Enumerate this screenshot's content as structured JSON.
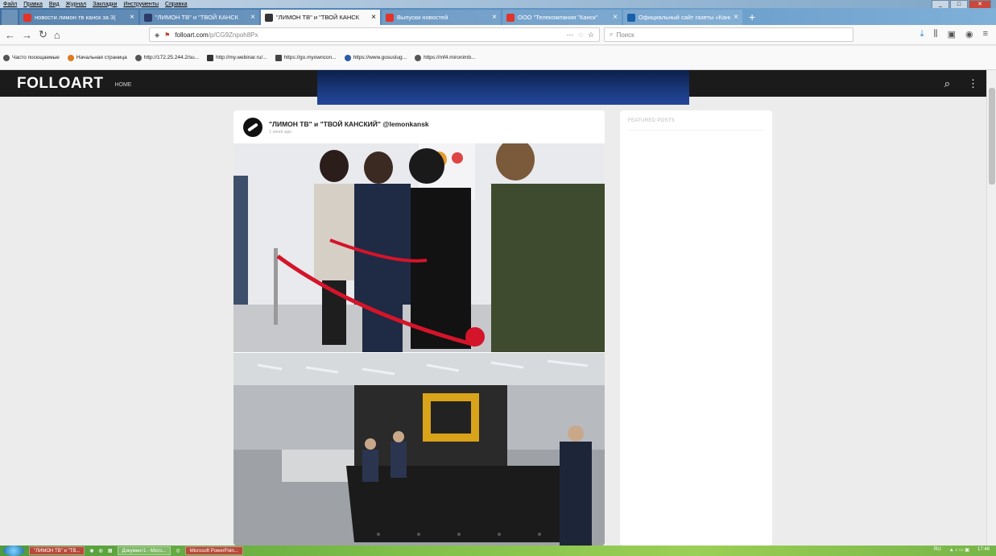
{
  "menu": [
    "Файл",
    "Правка",
    "Вид",
    "Журнал",
    "Закладки",
    "Инструменты",
    "Справка"
  ],
  "window_controls": [
    "_",
    "□",
    "✕"
  ],
  "tabs": [
    {
      "title": "новости лимон тв канск за 3(",
      "icon_color": "#e0342a"
    },
    {
      "title": "\"ЛИМОН ТВ\" и \"ТВОЙ КАНСК",
      "icon_color": "#2b3a67"
    },
    {
      "title": "\"ЛИМОН ТВ\" и \"ТВОЙ КАНСК",
      "icon_color": "#333333",
      "active": true
    },
    {
      "title": "Выпуски новостей",
      "icon_color": "#e0342a"
    },
    {
      "title": "ООО \"Телекомпания \"Канск\"",
      "icon_color": "#e0342a"
    },
    {
      "title": "Официальный сайт газеты «Канс",
      "icon_color": "#1a5fa8"
    }
  ],
  "urlbar": {
    "host": "folloart.com",
    "path": "/p/CG9Znpoh8Px",
    "more": "···",
    "bookmark": "☆"
  },
  "search": {
    "placeholder": "Поиск"
  },
  "bookmarks": [
    "Часто посещаемые",
    "Начальная страница",
    "http://172.25.244.2/su...",
    "http://my.webinar.ru/...",
    "https://go.myowncon...",
    "https://www.gosuslug...",
    "https://mf4.mironimb..."
  ],
  "site": {
    "logo": "FOLLOART",
    "nav_home": "HOME"
  },
  "post": {
    "author": "\"ЛИМОН ТВ\" и \"ТВОЙ КАНСКИЙ\" @lemonkansk",
    "time": "1 week ago"
  },
  "sidebar": {
    "heading": "FEATURED POSTS"
  },
  "taskbar": {
    "items": [
      "\"ЛИМОН ТВ\" и \"ТВ...",
      "Документ1 - Micro...",
      "Microsoft PowerPoin..."
    ],
    "lang": "RU",
    "clock": "17:46"
  }
}
